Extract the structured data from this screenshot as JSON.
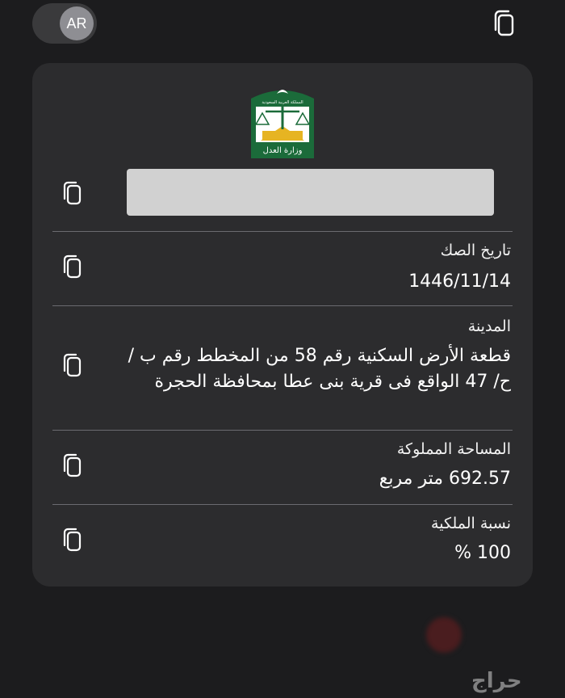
{
  "header": {
    "language_toggle_label": "AR"
  },
  "card": {
    "fields": [
      {
        "label": "",
        "value": ""
      },
      {
        "label": "تاريخ الصك",
        "value": "1446/11/14"
      },
      {
        "label": "المدينة",
        "value": "قطعة الأرض السكنية رقم 58 من المخطط رقم ب / ح/ 47 الواقع فى قرية بنى عطا بمحافظة الحجرة"
      },
      {
        "label": "المساحة المملوكة",
        "value": "692.57 متر مربع"
      },
      {
        "label": "نسبة الملكية",
        "value": "100 %"
      }
    ]
  },
  "emblem": {
    "text": "وزارة العدل",
    "top_text": "المملكة العربية السعودية",
    "colors": {
      "green": "#1b6b3a",
      "gold": "#e6b422",
      "white": "#ffffff"
    }
  },
  "watermark": {
    "text": "حراج"
  },
  "icons": {
    "copy": "copy-icon",
    "emblem": "ministry-emblem-icon"
  },
  "colors": {
    "background": "#1c1c1e",
    "card": "#2c2c2e",
    "divider": "#6b6b70",
    "redacted": "#d1d1d1"
  }
}
